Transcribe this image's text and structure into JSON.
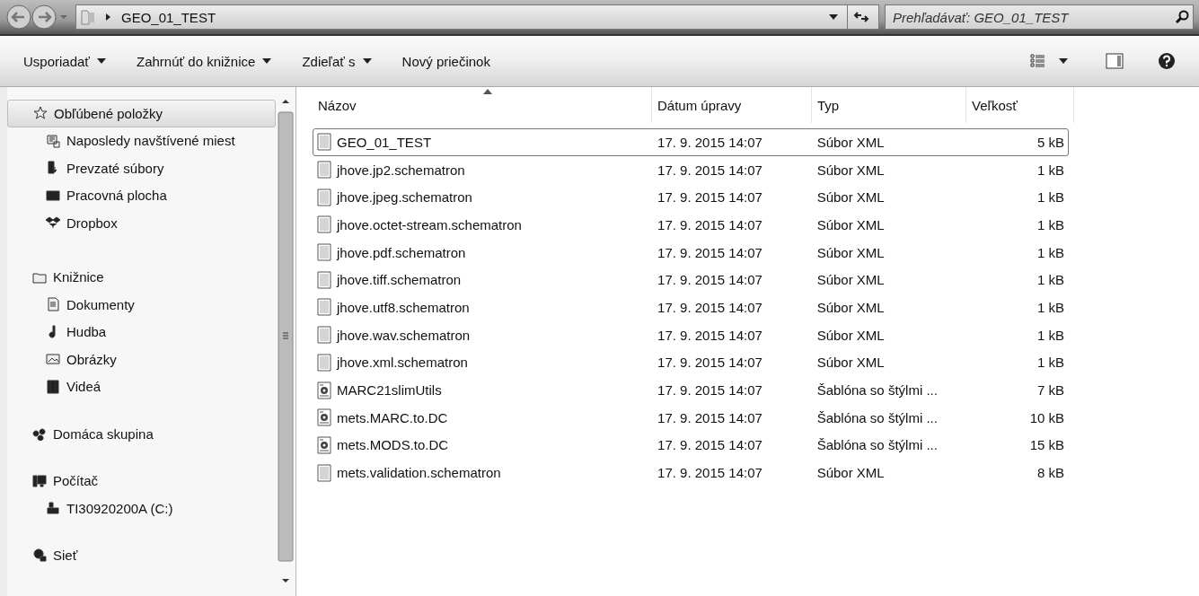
{
  "address_bar": {
    "breadcrumb": [
      "GEO_01_TEST"
    ],
    "search": {
      "placeholder": "Prehľadávať: GEO_01_TEST"
    }
  },
  "toolbar": {
    "buttons": [
      {
        "label": "Usporiadať",
        "has_menu": true
      },
      {
        "label": "Zahrnúť do knižnice",
        "has_menu": true
      },
      {
        "label": "Zdieľať s",
        "has_menu": true
      },
      {
        "label": "Nový priečinok",
        "has_menu": false
      }
    ]
  },
  "sidebar": {
    "groups": [
      {
        "label": "Obľúbené položky",
        "selected": true,
        "children": [
          {
            "label": "Naposledy navštívené miest",
            "selected": false
          },
          {
            "label": "Prevzaté súbory",
            "selected": false
          },
          {
            "label": "Pracovná plocha",
            "selected": false
          },
          {
            "label": "Dropbox",
            "selected": false
          }
        ]
      },
      {
        "label": "Knižnice",
        "selected": false,
        "children": [
          {
            "label": "Dokumenty",
            "selected": false
          },
          {
            "label": "Hudba",
            "selected": false
          },
          {
            "label": "Obrázky",
            "selected": false
          },
          {
            "label": "Videá",
            "selected": false
          }
        ]
      },
      {
        "label": "Domáca skupina",
        "selected": false
      },
      {
        "label": "Počítač",
        "selected": false,
        "children": [
          {
            "label": "TI30920200A (C:)",
            "selected": false
          }
        ]
      },
      {
        "label": "Sieť",
        "selected": false
      }
    ]
  },
  "file_list": {
    "columns": [
      {
        "label": "Názov",
        "sorted": true
      },
      {
        "label": "Dátum úpravy",
        "sorted": false
      },
      {
        "label": "Typ",
        "sorted": false
      },
      {
        "label": "Veľkosť",
        "sorted": false
      }
    ],
    "rows": [
      {
        "name": "GEO_01_TEST",
        "kind": "xml",
        "date": "17. 9. 2015 14:07",
        "type": "Súbor XML",
        "size": "5 kB",
        "selected": true
      },
      {
        "name": "jhove.jp2.schematron",
        "kind": "xml",
        "date": "17. 9. 2015 14:07",
        "type": "Súbor XML",
        "size": "1 kB",
        "selected": false
      },
      {
        "name": "jhove.jpeg.schematron",
        "kind": "xml",
        "date": "17. 9. 2015 14:07",
        "type": "Súbor XML",
        "size": "1 kB",
        "selected": false
      },
      {
        "name": "jhove.octet-stream.schematron",
        "kind": "xml",
        "date": "17. 9. 2015 14:07",
        "type": "Súbor XML",
        "size": "1 kB",
        "selected": false
      },
      {
        "name": "jhove.pdf.schematron",
        "kind": "xml",
        "date": "17. 9. 2015 14:07",
        "type": "Súbor XML",
        "size": "1 kB",
        "selected": false
      },
      {
        "name": "jhove.tiff.schematron",
        "kind": "xml",
        "date": "17. 9. 2015 14:07",
        "type": "Súbor XML",
        "size": "1 kB",
        "selected": false
      },
      {
        "name": "jhove.utf8.schematron",
        "kind": "xml",
        "date": "17. 9. 2015 14:07",
        "type": "Súbor XML",
        "size": "1 kB",
        "selected": false
      },
      {
        "name": "jhove.wav.schematron",
        "kind": "xml",
        "date": "17. 9. 2015 14:07",
        "type": "Súbor XML",
        "size": "1 kB",
        "selected": false
      },
      {
        "name": "jhove.xml.schematron",
        "kind": "xml",
        "date": "17. 9. 2015 14:07",
        "type": "Súbor XML",
        "size": "1 kB",
        "selected": false
      },
      {
        "name": "MARC21slimUtils",
        "kind": "xsl",
        "date": "17. 9. 2015 14:07",
        "type": "Šablóna so štýlmi ...",
        "size": "7 kB",
        "selected": false
      },
      {
        "name": "mets.MARC.to.DC",
        "kind": "xsl",
        "date": "17. 9. 2015 14:07",
        "type": "Šablóna so štýlmi ...",
        "size": "10 kB",
        "selected": false
      },
      {
        "name": "mets.MODS.to.DC",
        "kind": "xsl",
        "date": "17. 9. 2015 14:07",
        "type": "Šablóna so štýlmi ...",
        "size": "15 kB",
        "selected": false
      },
      {
        "name": "mets.validation.schematron",
        "kind": "xml",
        "date": "17. 9. 2015 14:07",
        "type": "Súbor XML",
        "size": "8 kB",
        "selected": false
      }
    ]
  }
}
